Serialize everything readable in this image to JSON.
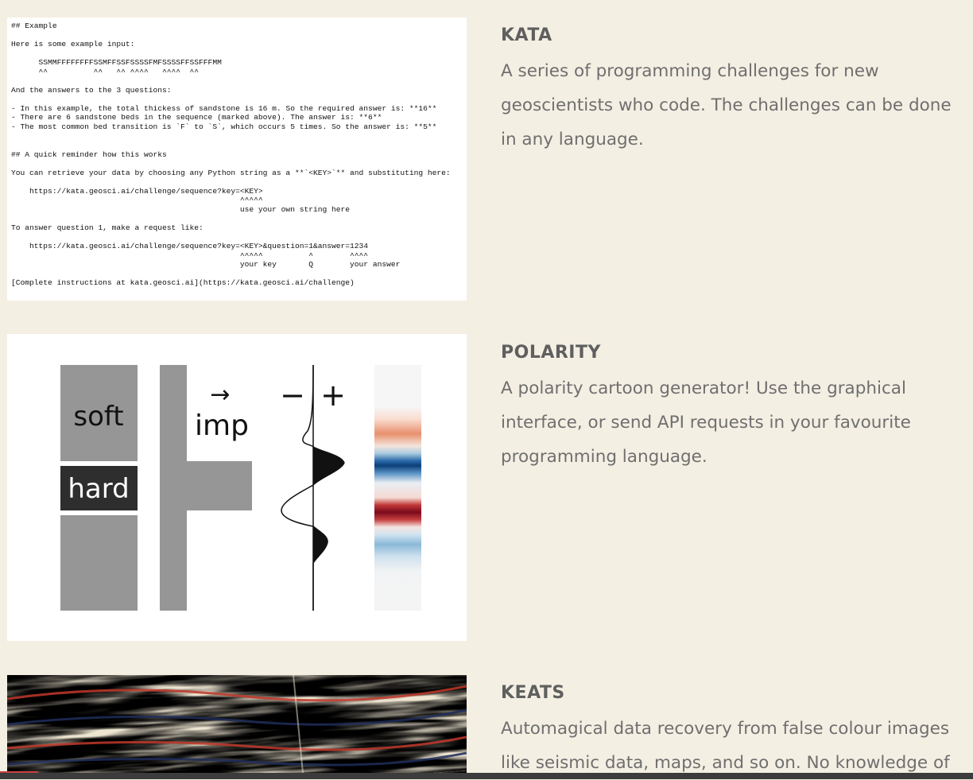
{
  "projects": [
    {
      "title": "KATA",
      "description": "A series of programming challenges for new geoscientists who code. The challenges can be done in any language.",
      "thumbnail": {
        "lines": [
          "## Example",
          "",
          "Here is some example input:",
          "",
          "      SSMMFFFFFFFFSSMFFSSFSSSSFMFSSSSFFSSFFFMM",
          "      ^^          ^^   ^^ ^^^^   ^^^^  ^^",
          "",
          "And the answers to the 3 questions:",
          "",
          "- In this example, the total thickess of sandstone is 16 m. So the required answer is: **16**",
          "- There are 6 sandstone beds in the sequence (marked above). The answer is: **6**",
          "- The most common bed transition is `F` to `S`, which occurs 5 times. So the answer is: **5**",
          "",
          "",
          "## A quick reminder how this works",
          "",
          "You can retrieve your data by choosing any Python string as a **`<KEY>`** and substituting here:",
          "",
          "    https://kata.geosci.ai/challenge/sequence?key=<KEY>",
          "                                                  ^^^^^",
          "                                                  use your own string here",
          "",
          "To answer question 1, make a request like:",
          "",
          "    https://kata.geosci.ai/challenge/sequence?key=<KEY>&question=1&answer=1234",
          "                                                  ^^^^^          ^        ^^^^",
          "                                                  your key       Q        your answer",
          "",
          "[Complete instructions at kata.geosci.ai](https://kata.geosci.ai/challenge)"
        ]
      }
    },
    {
      "title": "POLARITY",
      "description": "A polarity cartoon generator! Use the graphical interface, or send API requests in your favourite programming language.",
      "thumbnail": {
        "soft_label": "soft",
        "hard_label": "hard",
        "arrow_label": "→",
        "imp_label": "imp",
        "minus_label": "−",
        "plus_label": "+"
      }
    },
    {
      "title": "KEATS",
      "description": "Automagical data recovery from false colour images like seismic data, maps, and so on. No knowledge of"
    }
  ],
  "colors": {
    "background": "#f4efe3",
    "heading": "#5f5f5f",
    "text": "#6f6f6f",
    "rock_gray": "#969696",
    "rock_dark": "#2e2e2e"
  }
}
